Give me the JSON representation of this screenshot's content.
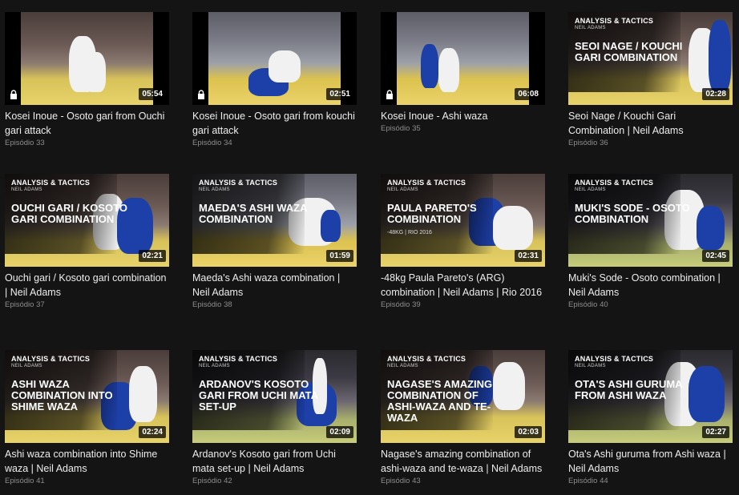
{
  "episodes": [
    {
      "title": "Kosei Inoue - Osoto gari from Ouchi gari attack",
      "episode": "Episódio 33",
      "duration": "05:54",
      "locked": true
    },
    {
      "title": "Kosei Inoue - Osoto gari from kouchi gari attack",
      "episode": "Episódio 34",
      "duration": "02:51",
      "locked": true
    },
    {
      "title": "Kosei Inoue - Ashi waza",
      "episode": "Episódio 35",
      "duration": "06:08",
      "locked": true
    },
    {
      "title": "Seoi Nage / Kouchi Gari Combination | Neil Adams",
      "episode": "Episódio 36",
      "duration": "02:28",
      "tag": "ANALYSIS & TACTICS",
      "tag_sub": "NEIL ADAMS",
      "headline": "SEOI NAGE / KOUCHI GARI COMBINATION"
    },
    {
      "title": "Ouchi gari / Kosoto gari combination | Neil Adams",
      "episode": "Episódio 37",
      "duration": "02:21",
      "tag": "ANALYSIS & TACTICS",
      "tag_sub": "NEIL ADAMS",
      "headline": "OUCHI GARI / KOSOTO GARI COMBINATION"
    },
    {
      "title": "Maeda's Ashi waza combination | Neil Adams",
      "episode": "Episódio 38",
      "duration": "01:59",
      "tag": "ANALYSIS & TACTICS",
      "tag_sub": "NEIL ADAMS",
      "headline": "MAEDA'S ASHI WAZA COMBINATION"
    },
    {
      "title": "-48kg Paula Pareto's (ARG) combination | Neil Adams | Rio 2016",
      "episode": "Episódio 39",
      "duration": "02:31",
      "tag": "ANALYSIS & TACTICS",
      "tag_sub": "NEIL ADAMS",
      "headline": "PAULA PARETO'S COMBINATION",
      "subline": "-48KG | RIO 2016"
    },
    {
      "title": "Muki's Sode - Osoto combination | Neil Adams",
      "episode": "Episódio 40",
      "duration": "02:45",
      "tag": "ANALYSIS & TACTICS",
      "tag_sub": "NEIL ADAMS",
      "headline": "MUKI'S SODE - OSOTO COMBINATION"
    },
    {
      "title": "Ashi waza combination into Shime waza | Neil Adams",
      "episode": "Episódio 41",
      "duration": "02:24",
      "tag": "ANALYSIS & TACTICS",
      "tag_sub": "NEIL ADAMS",
      "headline": "ASHI WAZA COMBINATION INTO SHIME WAZA"
    },
    {
      "title": "Ardanov's Kosoto gari from Uchi mata set-up | Neil Adams",
      "episode": "Episódio 42",
      "duration": "02:09",
      "tag": "ANALYSIS & TACTICS",
      "tag_sub": "NEIL ADAMS",
      "headline": "ARDANOV'S KOSOTO GARI FROM UCHI MATA SET-UP"
    },
    {
      "title": "Nagase's amazing combination of ashi-waza and te-waza | Neil Adams",
      "episode": "Episódio 43",
      "duration": "02:03",
      "tag": "ANALYSIS & TACTICS",
      "tag_sub": "NEIL ADAMS",
      "headline": "NAGASE'S AMAZING COMBINATION OF ASHI-WAZA AND TE-WAZA"
    },
    {
      "title": "Ota's Ashi guruma from Ashi waza | Neil Adams",
      "episode": "Episódio 44",
      "duration": "02:27",
      "tag": "ANALYSIS & TACTICS",
      "tag_sub": "NEIL ADAMS",
      "headline": "OTA'S ASHI GURUMA FROM ASHI WAZA"
    }
  ]
}
